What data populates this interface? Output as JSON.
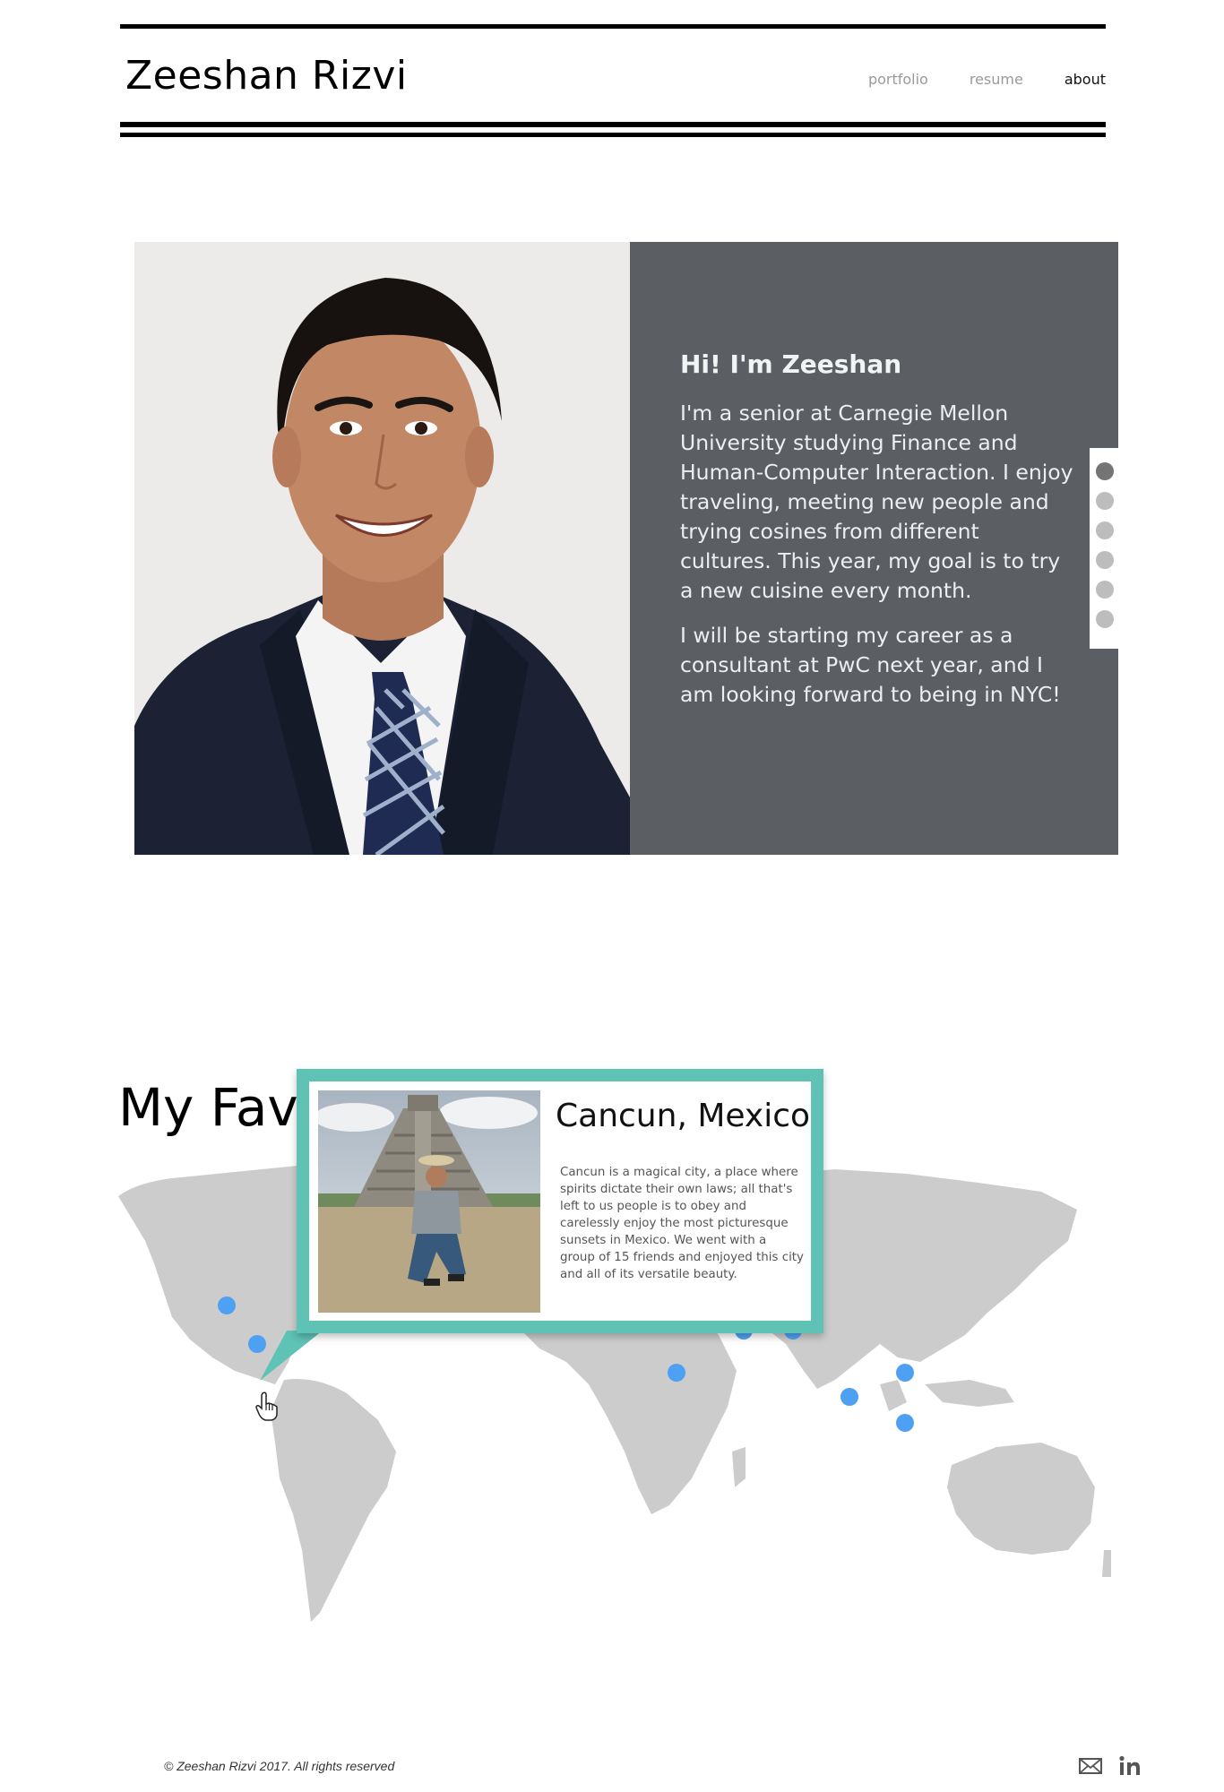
{
  "header": {
    "site_title": "Zeeshan Rizvi",
    "nav": [
      {
        "label": "portfolio"
      },
      {
        "label": "resume"
      },
      {
        "label": "about"
      }
    ]
  },
  "hero": {
    "heading": "Hi! I'm Zeeshan",
    "paragraphs": [
      "I'm a senior at Carnegie Mellon University studying Finance and Human-Computer Interaction. I enjoy traveling, meeting new people and trying cosines from different cultures. This year, my goal is to try a new cuisine every month.",
      "I will be starting my career as a consultant at PwC next year, and I am looking forward to being in NYC!"
    ],
    "slide_count": 6,
    "active_slide": 1
  },
  "map_section": {
    "heading": "My Favo",
    "pin_color": "#4ea1f2"
  },
  "popup": {
    "title": "Cancun, Mexico",
    "description": "Cancun is a magical city, a place where spirits dictate their own laws; all that's left to us people is to obey and carelessly enjoy the most picturesque sunsets in Mexico. We went with a group of 15 friends and enjoyed this city and all of its versatile beauty.",
    "accent_color": "#5ec2b5"
  },
  "footer": {
    "copyright": "© Zeeshan Rizvi 2017. All rights reserved",
    "icons": [
      "mail-icon",
      "linkedin-icon"
    ]
  }
}
